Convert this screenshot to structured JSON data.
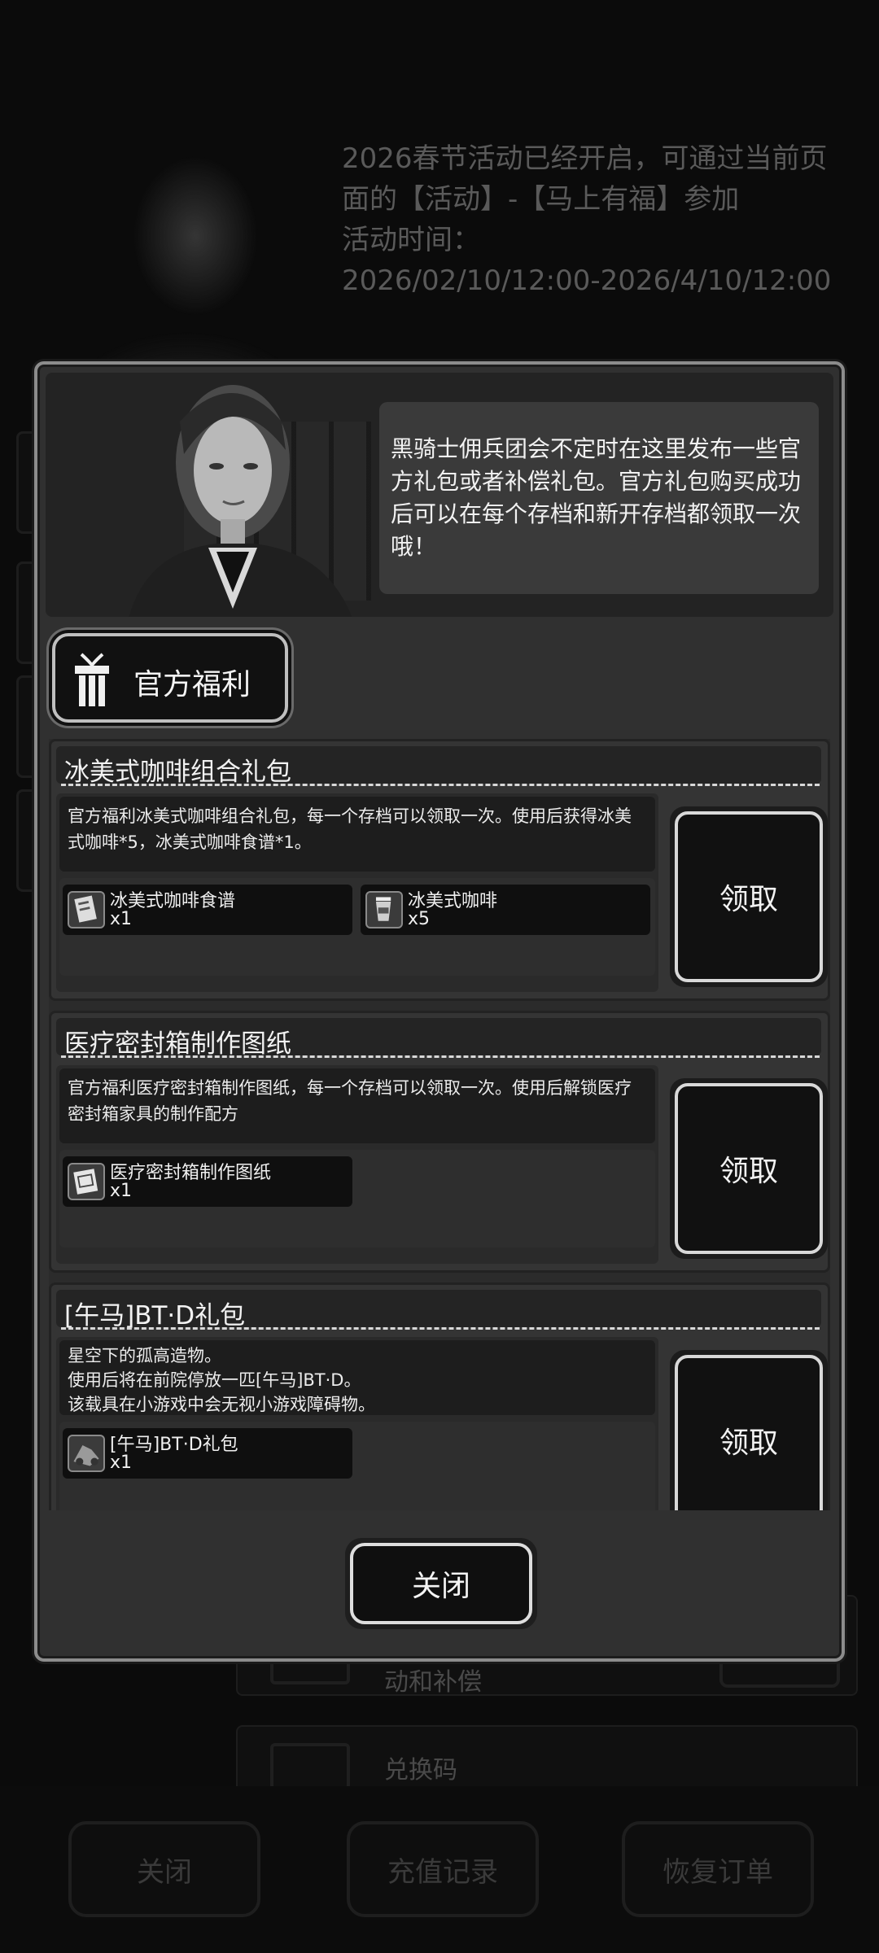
{
  "background": {
    "notice_lines": [
      "2026春节活动已经开启，可通过当前页",
      "面的【活动】-【马上有福】参加",
      "活动时间：",
      "2026/02/10/12:00-2026/4/10/12:00"
    ],
    "list_items": [
      {
        "label": "动和补偿"
      },
      {
        "label": "兑换码"
      }
    ],
    "bottom_buttons": {
      "close": "关闭",
      "recharge_history": "充值记录",
      "restore_order": "恢复订单"
    }
  },
  "modal": {
    "npc_message": "黑骑士佣兵团会不定时在这里发布一些官方礼包或者补偿礼包。官方礼包购买成功后可以在每个存档和新开存档都领取一次哦！",
    "section_title": "官方福利",
    "gifts": [
      {
        "title": "冰美式咖啡组合礼包",
        "description": "官方福利冰美式咖啡组合礼包，每一个存档可以领取一次。使用后获得冰美式咖啡*5，冰美式咖啡食谱*1。",
        "rewards": [
          {
            "name": "冰美式咖啡食谱",
            "qty": "x1",
            "icon": "recipe-icon"
          },
          {
            "name": "冰美式咖啡",
            "qty": "x5",
            "icon": "coffee-cup-icon"
          }
        ],
        "claim_label": "领取"
      },
      {
        "title": "医疗密封箱制作图纸",
        "description": "官方福利医疗密封箱制作图纸，每一个存档可以领取一次。使用后解锁医疗密封箱家具的制作配方",
        "rewards": [
          {
            "name": "医疗密封箱制作图纸",
            "qty": "x1",
            "icon": "blueprint-icon"
          }
        ],
        "claim_label": "领取"
      },
      {
        "title": "[午马]BT·D礼包",
        "description": "星空下的孤高造物。\n使用后将在前院停放一匹[午马]BT·D。\n该载具在小游戏中会无视小游戏障碍物。",
        "rewards": [
          {
            "name": "[午马]BT·D礼包",
            "qty": "x1",
            "icon": "vehicle-icon"
          }
        ],
        "claim_label": "领取"
      }
    ],
    "close_label": "关闭"
  }
}
